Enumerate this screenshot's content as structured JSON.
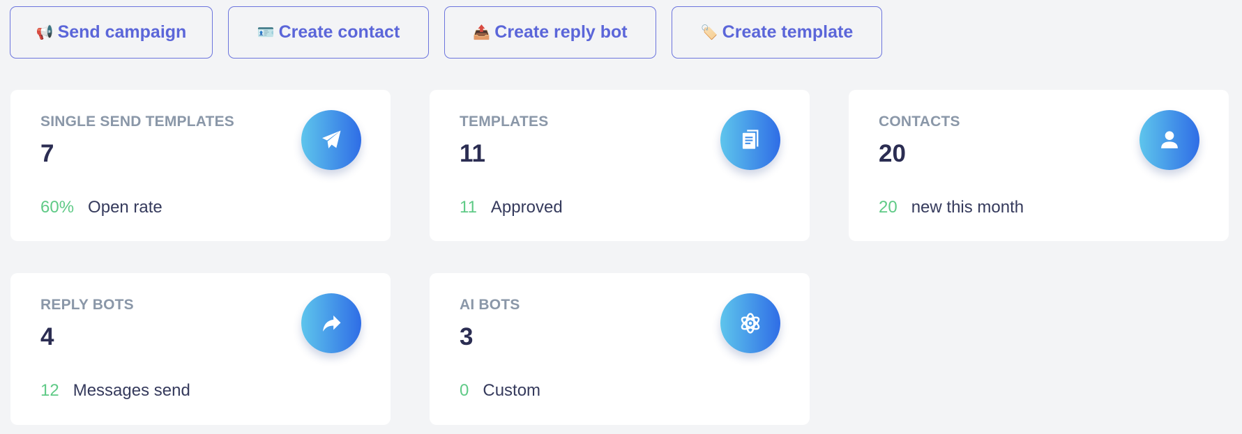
{
  "actions": [
    {
      "icon": "📢",
      "icon_name": "megaphone-icon",
      "label": "Send campaign"
    },
    {
      "icon": "🪪",
      "icon_name": "id-card-icon",
      "label": "Create contact"
    },
    {
      "icon": "📤",
      "icon_name": "outbox-tray-icon",
      "label": "Create reply bot"
    },
    {
      "icon": "🏷️",
      "icon_name": "label-tag-icon",
      "label": "Create template"
    }
  ],
  "stats": [
    {
      "title": "SINGLE SEND TEMPLATES",
      "value": "7",
      "sub_value": "60%",
      "sub_label": "Open rate",
      "icon": "paper-plane-icon"
    },
    {
      "title": "TEMPLATES",
      "value": "11",
      "sub_value": "11",
      "sub_label": "Approved",
      "icon": "documents-icon"
    },
    {
      "title": "CONTACTS",
      "value": "20",
      "sub_value": "20",
      "sub_label": "new this month",
      "icon": "user-icon"
    },
    {
      "title": "REPLY BOTS",
      "value": "4",
      "sub_value": "12",
      "sub_label": "Messages send",
      "icon": "share-arrow-icon"
    },
    {
      "title": "AI BOTS",
      "value": "3",
      "sub_value": "0",
      "sub_label": "Custom",
      "icon": "atom-icon"
    }
  ],
  "colors": {
    "accent": "#5b66d9",
    "positive": "#5fca86",
    "badge_gradient_start": "#5ec5ec",
    "badge_gradient_end": "#2f6de6"
  }
}
